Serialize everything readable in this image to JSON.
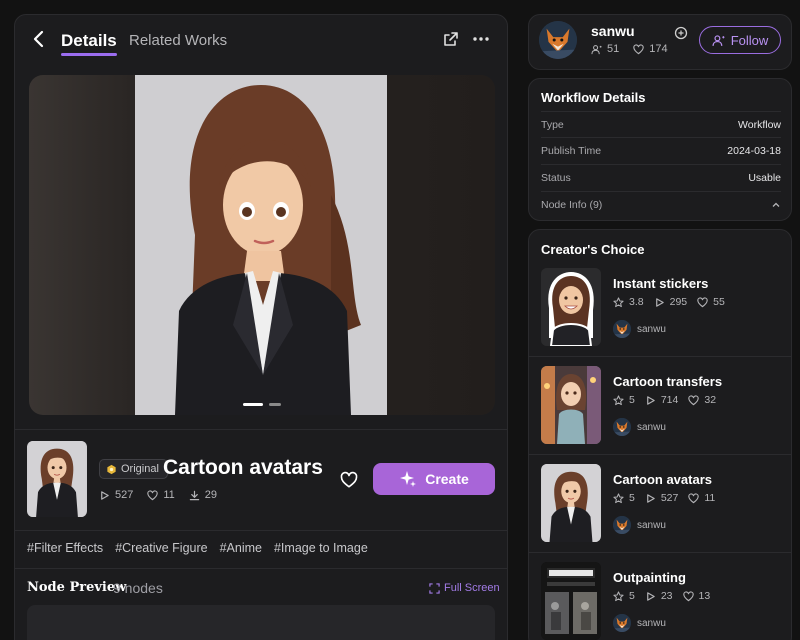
{
  "header": {
    "tab_details": "Details",
    "tab_related": "Related Works"
  },
  "work": {
    "badge": "Original",
    "title": "Cartoon avatars",
    "runs": "527",
    "likes": "11",
    "downloads": "29",
    "create_label": "Create",
    "tags": [
      "#Filter Effects",
      "#Creative Figure",
      "#Anime",
      "#Image to Image"
    ]
  },
  "node_preview": {
    "title": "Node Preview",
    "count": "9 nodes",
    "fullscreen": "Full Screen"
  },
  "profile": {
    "name": "sanwu",
    "followers": "51",
    "likes": "174",
    "follow_label": "Follow"
  },
  "workflow_details": {
    "title": "Workflow Details",
    "rows": [
      {
        "key": "Type",
        "value": "Workflow"
      },
      {
        "key": "Publish Time",
        "value": "2024-03-18"
      },
      {
        "key": "Status",
        "value": "Usable"
      },
      {
        "key": "Node Info (9)",
        "value": ""
      }
    ]
  },
  "creators_choice": {
    "title": "Creator's Choice",
    "items": [
      {
        "name": "Instant stickers",
        "rating": "3.8",
        "runs": "295",
        "likes": "55",
        "author": "sanwu"
      },
      {
        "name": "Cartoon transfers",
        "rating": "5",
        "runs": "714",
        "likes": "32",
        "author": "sanwu"
      },
      {
        "name": "Cartoon avatars",
        "rating": "5",
        "runs": "527",
        "likes": "11",
        "author": "sanwu"
      },
      {
        "name": "Outpainting",
        "rating": "5",
        "runs": "23",
        "likes": "13",
        "author": "sanwu"
      }
    ]
  },
  "colors": {
    "accent": "#a865d8",
    "background": "#121212",
    "card": "#1c1c1e"
  },
  "icons": [
    "back-arrow-icon",
    "share-icon",
    "more-icon",
    "heart-icon",
    "sparkle-icon",
    "fullscreen-icon",
    "play-icon",
    "star-icon",
    "download-icon",
    "user-plus-icon",
    "chevron-up-icon"
  ]
}
